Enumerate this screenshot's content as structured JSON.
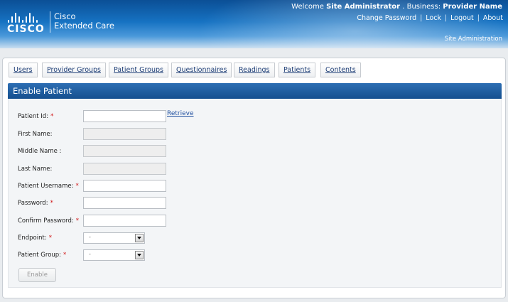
{
  "header": {
    "brand": "CISCO",
    "product_line1": "Cisco",
    "product_line2": "Extended Care",
    "welcome_prefix": "Welcome",
    "user_name": "Site Administrator",
    "business_prefix": ". Business:",
    "business_name": "Provider Name",
    "links": [
      "Change Password",
      "Lock",
      "Logout",
      "About"
    ],
    "context": "Site Administration"
  },
  "tabs": [
    "Users",
    "Provider Groups",
    "Patient Groups",
    "Questionnaires",
    "Readings",
    "Patients",
    "Contents"
  ],
  "section_title": "Enable Patient",
  "form": {
    "patient_id_label": "Patient Id:",
    "retrieve_label": "Retrieve",
    "first_name_label": "First Name:",
    "middle_name_label": "Middle Name :",
    "last_name_label": "Last Name:",
    "username_label": "Patient Username:",
    "password_label": "Password:",
    "confirm_password_label": "Confirm Password:",
    "endpoint_label": "Endpoint:",
    "endpoint_value": "-",
    "group_label": "Patient Group:",
    "group_value": "-",
    "required_mark": "*",
    "enable_button": "Enable"
  }
}
